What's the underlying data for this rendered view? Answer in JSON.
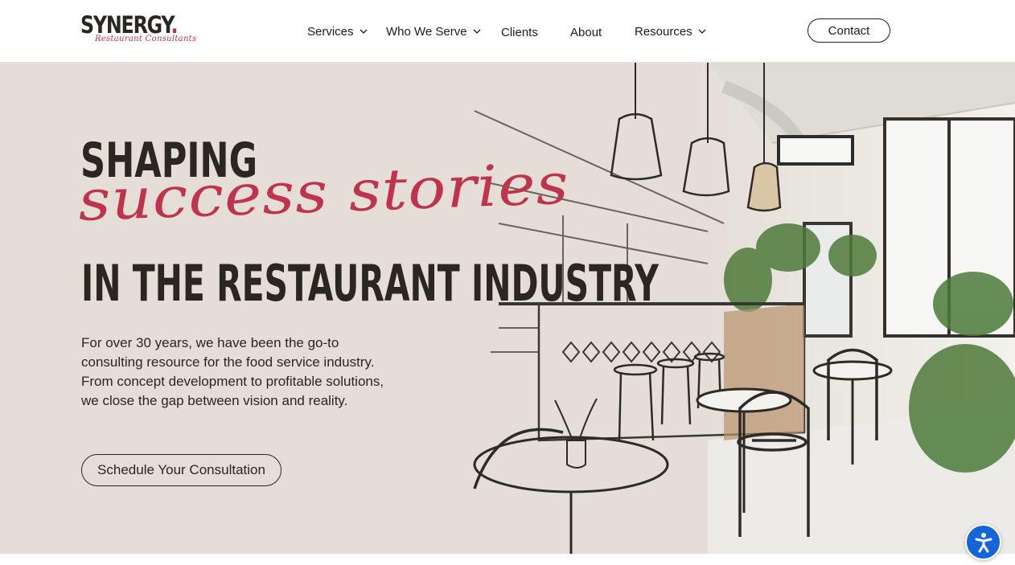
{
  "brand": {
    "name": "SYNERGY",
    "dot": ".",
    "tagline": "Restaurant Consultants",
    "accent_color": "#c0334d",
    "text_color": "#2b2620"
  },
  "nav": {
    "items": [
      {
        "label": "Services",
        "has_dropdown": true
      },
      {
        "label": "Who We Serve",
        "has_dropdown": true
      },
      {
        "label": "Clients",
        "has_dropdown": false
      },
      {
        "label": "About",
        "has_dropdown": false
      },
      {
        "label": "Resources",
        "has_dropdown": true
      }
    ],
    "contact_label": "Contact"
  },
  "hero": {
    "line1": "SHAPING",
    "line2": "success stories",
    "line3": "IN THE RESTAURANT INDUSTRY",
    "description": "For over 30 years, we have been the go-to consulting resource for the food service industry. From concept development to profitable solutions, we close the gap between vision and reality.",
    "cta_label": "Schedule Your Consultation",
    "background_color": "#e4ded6"
  },
  "accessibility": {
    "icon": "accessibility-icon",
    "color": "#1565d8"
  }
}
